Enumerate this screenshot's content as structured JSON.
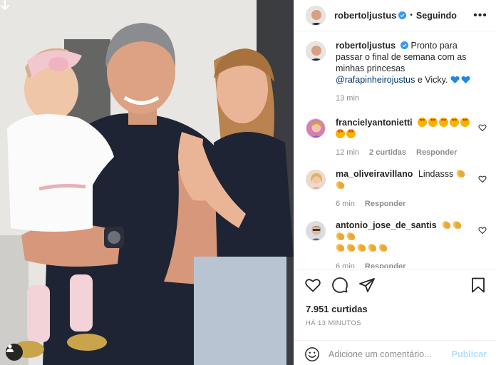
{
  "post": {
    "username": "robertoljustus",
    "follow_status": "Seguindo",
    "separator": "•",
    "more_label": "•••",
    "caption": {
      "text_before": "Pronto para passar o final de semana com as minhas princesas",
      "mention": "@rafapinheirojustus",
      "text_after": "e Vicky.",
      "time": "13 min"
    },
    "likes": "7.951 curtidas",
    "time_ago": "HÁ 13 MINUTOS"
  },
  "comments": [
    {
      "username": "francielyantonietti",
      "time": "12 min",
      "likes": "2 curtidas",
      "reply": "Responder",
      "emoji_line1": [
        "star-struck",
        "star-struck",
        "star-struck",
        "star-struck",
        "star-struck"
      ],
      "emoji_line2": [
        "star-struck",
        "star-struck"
      ]
    },
    {
      "username": "ma_oliveiravillano",
      "text": "Lindasss",
      "time": "6 min",
      "reply": "Responder",
      "emojis": [
        "clapping-hands",
        "clapping-hands"
      ]
    },
    {
      "username": "antonio_jose_de_santis",
      "time": "6 min",
      "reply": "Responder",
      "emoji_line1": [
        "clapping-hands",
        "clapping-hands",
        "clapping-hands",
        "clapping-hands"
      ],
      "emoji_line2": [
        "clapping-hands",
        "clapping-hands",
        "clapping-hands",
        "clapping-hands",
        "clapping-hands"
      ]
    }
  ],
  "add_comment": {
    "placeholder": "Adicione um comentário...",
    "publish_label": "Publicar"
  },
  "colors": {
    "verified": "#3897f0",
    "mention": "#00376b",
    "muted": "#8e8e8e",
    "publish_disabled": "#b2dffc",
    "blue_heart": "#1e88e5"
  }
}
